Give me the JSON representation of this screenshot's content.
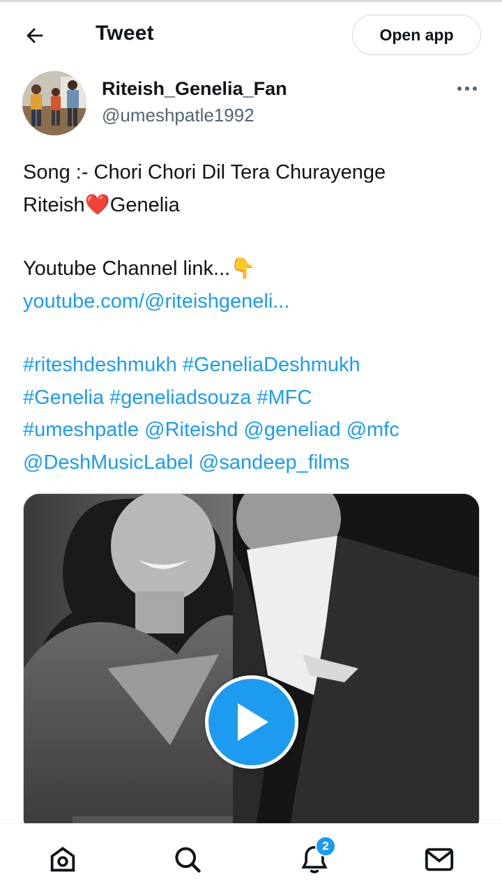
{
  "header": {
    "title": "Tweet",
    "open_app_label": "Open app"
  },
  "author": {
    "display_name": "Riteish_Genelia_Fan",
    "handle": "@umeshpatle1992"
  },
  "tweet": {
    "line1": "Song :- Chori Chori Dil Tera Churayenge",
    "line2_before": "Riteish",
    "line2_emoji": "❤️",
    "line2_after": "Genelia",
    "line3": "Youtube Channel link...",
    "line3_emoji": "👇",
    "link": "youtube.com/@riteishgeneli...",
    "tags": [
      "#riteshdeshmukh",
      "#GeneliaDeshmukh",
      "#Genelia",
      "#geneliadsouza",
      "#MFC",
      "#umeshpatle",
      "@Riteishd",
      "@geneliad",
      "@mfc",
      "@DeshMusicLabel",
      "@sandeep_films"
    ]
  },
  "nav": {
    "notifications_badge": "2"
  },
  "colors": {
    "accent": "#1d9bf0",
    "text": "#0f1419",
    "muted": "#536471"
  }
}
